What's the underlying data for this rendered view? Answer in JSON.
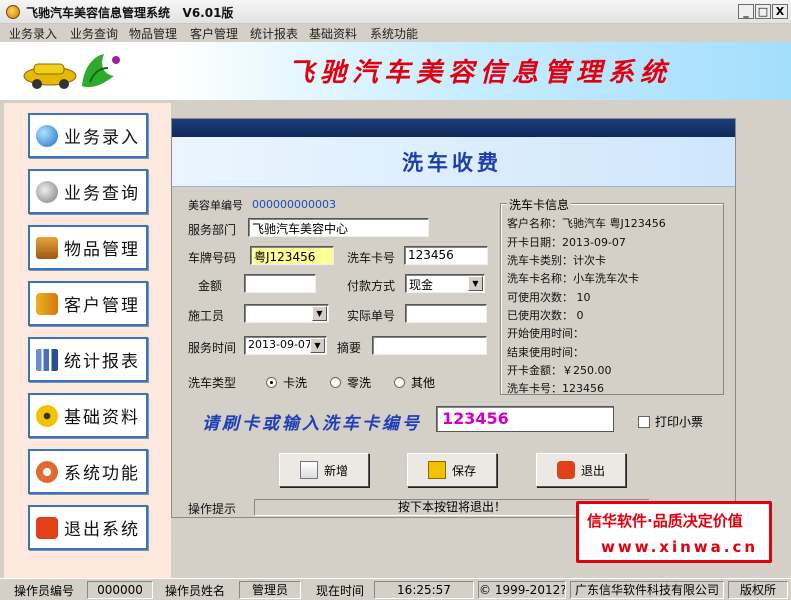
{
  "window": {
    "title": "飞驰汽车美容信息管理系统   V6.01版",
    "minimize": "_",
    "restore": "□",
    "close": "X"
  },
  "menu": [
    "业务录入",
    "业务查询",
    "物品管理",
    "客户管理",
    "统计报表",
    "基础资料",
    "系统功能"
  ],
  "banner": {
    "title": "飞驰汽车美容信息管理系统"
  },
  "sidebar": {
    "items": [
      {
        "label": "业务录入",
        "icon": "globe-icon"
      },
      {
        "label": "业务查询",
        "icon": "search-icon"
      },
      {
        "label": "物品管理",
        "icon": "box-icon"
      },
      {
        "label": "客户管理",
        "icon": "users-icon"
      },
      {
        "label": "统计报表",
        "icon": "bar-chart-icon"
      },
      {
        "label": "基础资料",
        "icon": "radiation-icon"
      },
      {
        "label": "系统功能",
        "icon": "gear-icon"
      },
      {
        "label": "退出系统",
        "icon": "power-icon"
      }
    ]
  },
  "form": {
    "title": "洗车收费",
    "order_no_label": "美容单编号",
    "order_no": "000000000003",
    "dept_label": "服务部门",
    "dept": "飞驰汽车美容中心",
    "plate_label": "车牌号码",
    "plate": "粤J123456",
    "card_no_label": "洗车卡号",
    "card_no": "123456",
    "amount_label": "金额",
    "amount": "",
    "pay_label": "付款方式",
    "pay": "现金",
    "worker_label": "施工员",
    "worker": "",
    "actual_no_label": "实际单号",
    "actual_no": "",
    "time_label": "服务时间",
    "time": "2013-09-07",
    "memo_label": "摘要",
    "memo": "",
    "type_label": "洗车类型",
    "types": [
      {
        "label": "卡洗",
        "selected": true
      },
      {
        "label": "零洗",
        "selected": false
      },
      {
        "label": "其他",
        "selected": false
      }
    ]
  },
  "card_info": {
    "legend": "洗车卡信息",
    "lines": [
      "客户名称：飞驰汽车        粤J123456",
      "开卡日期：2013-09-07",
      "洗车卡类别：计次卡",
      "洗车卡名称：小车洗车次卡",
      "可使用次数：  10",
      "已使用次数：  0",
      "开始使用时间：",
      "结束使用时间：",
      "开卡金额：￥250.00",
      "洗车卡号：123456"
    ]
  },
  "swipe": {
    "label": "请刷卡或输入洗车卡编号",
    "value": "123456",
    "print_label": "打印小票"
  },
  "buttons": {
    "new": "新增",
    "save": "保存",
    "exit": "退出"
  },
  "hint": {
    "label": "操作提示",
    "text": "按下本按钮将退出！"
  },
  "promo": {
    "line1": "信华软件·品质决定价值",
    "line2": "www.xinwa.cn"
  },
  "status": {
    "op_no_label": "操作员编号",
    "op_no": "000000",
    "op_name_label": "操作员姓名",
    "op_name": "管理员",
    "now_label": "现在时间",
    "now": "16:25:57",
    "copyright": "© 1999-2012?",
    "company": "广东信华软件科技有限公司",
    "rights": "版权所"
  },
  "colors": {
    "accent_red": "#e0000f",
    "title_blue": "#1f3fa8",
    "card_magenta": "#d000c8"
  }
}
